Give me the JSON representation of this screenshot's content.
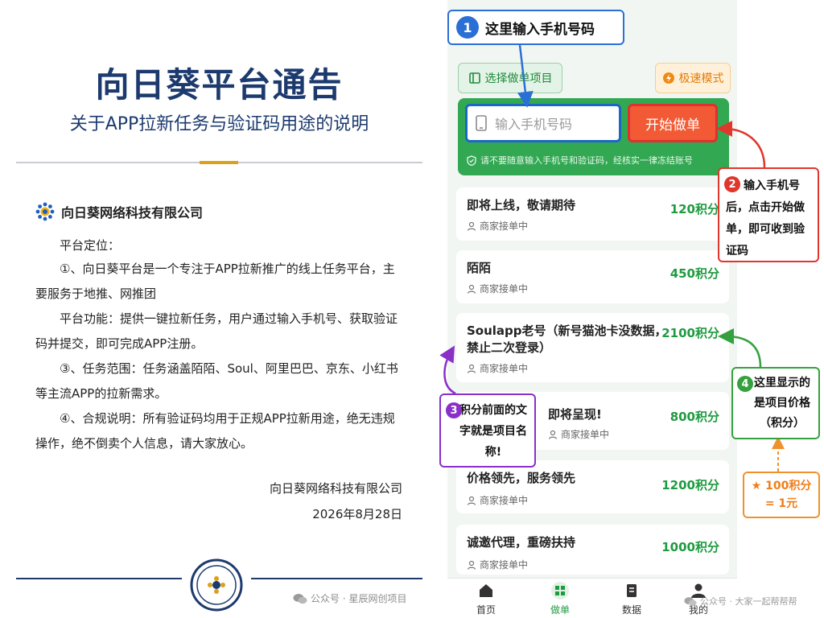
{
  "notice": {
    "title": "向日葵平台通告",
    "subtitle": "关于APP拉新任务与验证码用途的说明",
    "company": "向日葵网络科技有限公司",
    "position_heading": "平台定位：",
    "p1": "①、向日葵平台是一个专注于APP拉新推广的线上任务平台，主要服务于地推、网推团",
    "p2": "平台功能：提供一键拉新任务，用户通过输入手机号、获取验证码并提交，即可完成APP注册。",
    "p3": "③、任务范围：任务涵盖陌陌、Soul、阿里巴巴、京东、小红书等主流APP的拉新需求。",
    "p4": "④、合规说明：所有验证码均用于正规APP拉新用途，绝无违规操作，绝不倒卖个人信息，请大家放心。",
    "sign_company": "向日葵网络科技有限公司",
    "sign_date": "2026年8月28日"
  },
  "watermarks": {
    "left": "公众号 · 星辰网创项目",
    "right": "公众号 · 大家一起帮帮帮"
  },
  "app": {
    "select_project": "选择做单项目",
    "speed_mode": "极速模式",
    "phone_placeholder": "输入手机号码",
    "start_button": "开始做单",
    "warning": "请不要随意输入手机号和验证码，经核实一律冻结账号",
    "tasks": [
      {
        "title": "即将上线，敬请期待",
        "sub": "商家接单中",
        "price": "120积分"
      },
      {
        "title": "陌陌",
        "sub": "商家接单中",
        "price": "450积分"
      },
      {
        "title": "Soulapp老号（新号猫池卡没数据，禁止二次登录）",
        "sub": "商家接单中",
        "price": "2100积分"
      },
      {
        "title": "即将呈现!",
        "sub": "商家接单中",
        "price": "800积分"
      },
      {
        "title": "价格领先，服务领先",
        "sub": "商家接单中",
        "price": "1200积分"
      },
      {
        "title": "诚邀代理，重磅扶持",
        "sub": "商家接单中",
        "price": "1000积分"
      }
    ],
    "nav": [
      "首页",
      "做单",
      "数据",
      "我的"
    ]
  },
  "annotations": {
    "n1": "1",
    "t1": "这里输入手机号码",
    "n2": "2",
    "t2": "输入手机号后，点击开始做单，即可收到验证码",
    "n3": "3",
    "t3": "积分前面的文字就是项目名称!",
    "n4": "4",
    "t4": "这里显示的是项目价格（积分）",
    "t5a": "★ 100积分",
    "t5b": "= 1元"
  },
  "colors": {
    "title_navy": "#1c3a6e",
    "app_green": "#32a852",
    "price_green": "#1e9b3f",
    "start_orange": "#f15a34",
    "blue": "#2a6fd6",
    "red": "#e0362c",
    "purple": "#8b2fc9",
    "orange": "#f0922b"
  }
}
